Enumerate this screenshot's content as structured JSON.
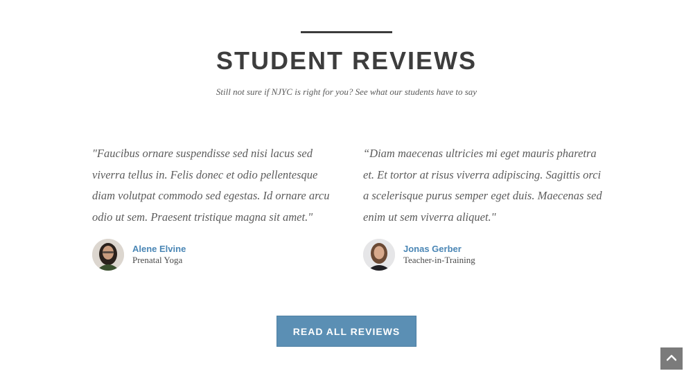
{
  "section": {
    "title": "STUDENT REVIEWS",
    "subtitle": "Still not sure if NJYC is right for you? See what our students have to say"
  },
  "reviews": [
    {
      "quote": "\"Faucibus ornare suspendisse sed nisi lacus sed viverra tellus in. Felis donec et odio pellentesque diam volutpat commodo sed egestas. Id ornare arcu odio ut sem. Praesent tristique magna sit amet.\"",
      "name": "Alene Elvine",
      "role": "Prenatal Yoga"
    },
    {
      "quote": "“Diam maecenas ultricies mi eget mauris pharetra et. Et tortor at risus viverra adipiscing. Sagittis orci a scelerisque purus semper eget duis. Maecenas sed enim ut sem viverra aliquet.\"",
      "name": "Jonas Gerber",
      "role": "Teacher-in-Training"
    }
  ],
  "cta": {
    "label": "READ ALL REVIEWS"
  },
  "colors": {
    "accent": "#5b8fb4",
    "name_link": "#4a86b5",
    "heading": "#3d3d3d",
    "to_top_bg": "#7b7b7b"
  },
  "icons": {
    "to_top": "chevron-up-icon"
  }
}
